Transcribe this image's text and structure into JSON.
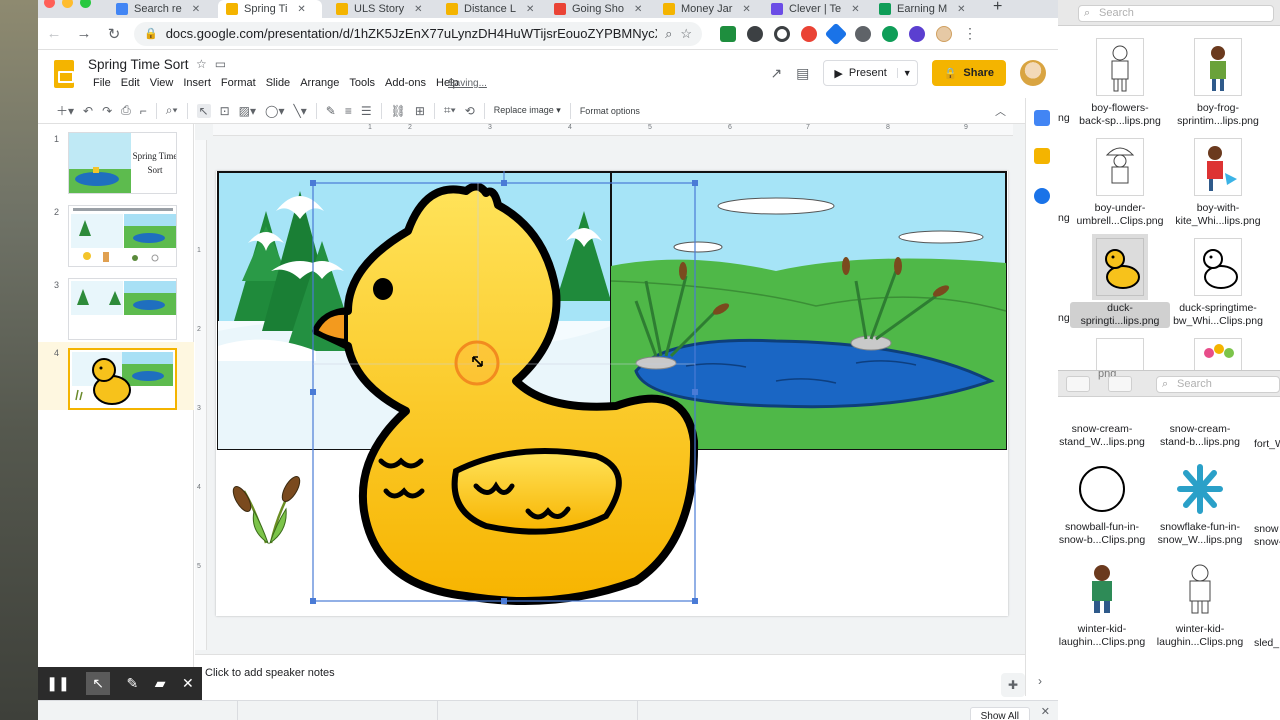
{
  "browser": {
    "tabs": [
      {
        "label": "Search re",
        "color": "#4285f4",
        "active": false
      },
      {
        "label": "Spring Ti",
        "color": "#f4b400",
        "active": true
      },
      {
        "label": "ULS Story",
        "color": "#f4b400",
        "active": false
      },
      {
        "label": "Distance L",
        "color": "#f4b400",
        "active": false
      },
      {
        "label": "Going Sho",
        "color": "#ea4335",
        "active": false
      },
      {
        "label": "Money Jar",
        "color": "#f4b400",
        "active": false
      },
      {
        "label": "Clever | Te",
        "color": "#6b4ce6",
        "active": false
      },
      {
        "label": "Earning M",
        "color": "#0f9d58",
        "active": false
      }
    ],
    "new_tab": "+",
    "url": "docs.google.com/presentation/d/1hZK5JzEnX77uLynzDH4HuWTijsrEouoZYPBMNycXV..."
  },
  "docs": {
    "title": "Spring Time Sort",
    "menu": [
      "File",
      "Edit",
      "View",
      "Insert",
      "Format",
      "Slide",
      "Arrange",
      "Tools",
      "Add-ons",
      "Help"
    ],
    "saving": "Saving...",
    "present_label": "Present",
    "share_label": "Share"
  },
  "toolbar": {
    "replace_image": "Replace image ▾",
    "format_options": "Format options"
  },
  "filmstrip": {
    "slides": [
      {
        "num": "1",
        "title_text": "Spring Time Sort"
      },
      {
        "num": "2"
      },
      {
        "num": "3"
      },
      {
        "num": "4"
      }
    ]
  },
  "ruler": {
    "h_ticks": [
      "1",
      "2",
      "3",
      "4",
      "5",
      "6",
      "7",
      "8",
      "9"
    ],
    "v_ticks": [
      "1",
      "2",
      "3",
      "4",
      "5"
    ]
  },
  "speaker_notes": {
    "placeholder": "Click to add speaker notes"
  },
  "downloads": {
    "show_all": "Show All"
  },
  "finder_top": {
    "search_placeholder": "Search",
    "files": [
      {
        "name": "boy-flowers-\nback-sp...lips.png",
        "selected": false
      },
      {
        "name": "boy-frog-\nsprintim...lips.png",
        "selected": false
      },
      {
        "name": "boy-under-\numbrell...Clips.png",
        "selected": false
      },
      {
        "name": "boy-with-\nkite_Whi...lips.png",
        "selected": false
      },
      {
        "name": "duck-\nspringti...lips.png",
        "selected": true
      },
      {
        "name": "duck-springtime-\nbw_Whi...Clips.png",
        "selected": false
      }
    ],
    "edge_labels": [
      "ng",
      "ng",
      "ng"
    ]
  },
  "finder_bot": {
    "search_placeholder": "Search",
    "partial_label": "png",
    "files": [
      {
        "name": "snow-cream-\nstand_W...lips.png"
      },
      {
        "name": "snow-cream-\nstand-b...lips.png"
      },
      {
        "name": "snowball-fun-in-\nsnow-b...Clips.png"
      },
      {
        "name": "snowflake-fun-in-\nsnow_W...lips.png"
      },
      {
        "name": "winter-kid-\nlaughin...Clips.png"
      },
      {
        "name": "winter-kid-\nlaughin...Clips.png"
      }
    ],
    "edge_labels": [
      "fort_W",
      "snow\nsnow-",
      "sled_"
    ]
  },
  "colors": {
    "slides_yellow": "#f4b400",
    "selection_blue": "#4a7bd6",
    "pointer_ring": "#f28b1f"
  }
}
